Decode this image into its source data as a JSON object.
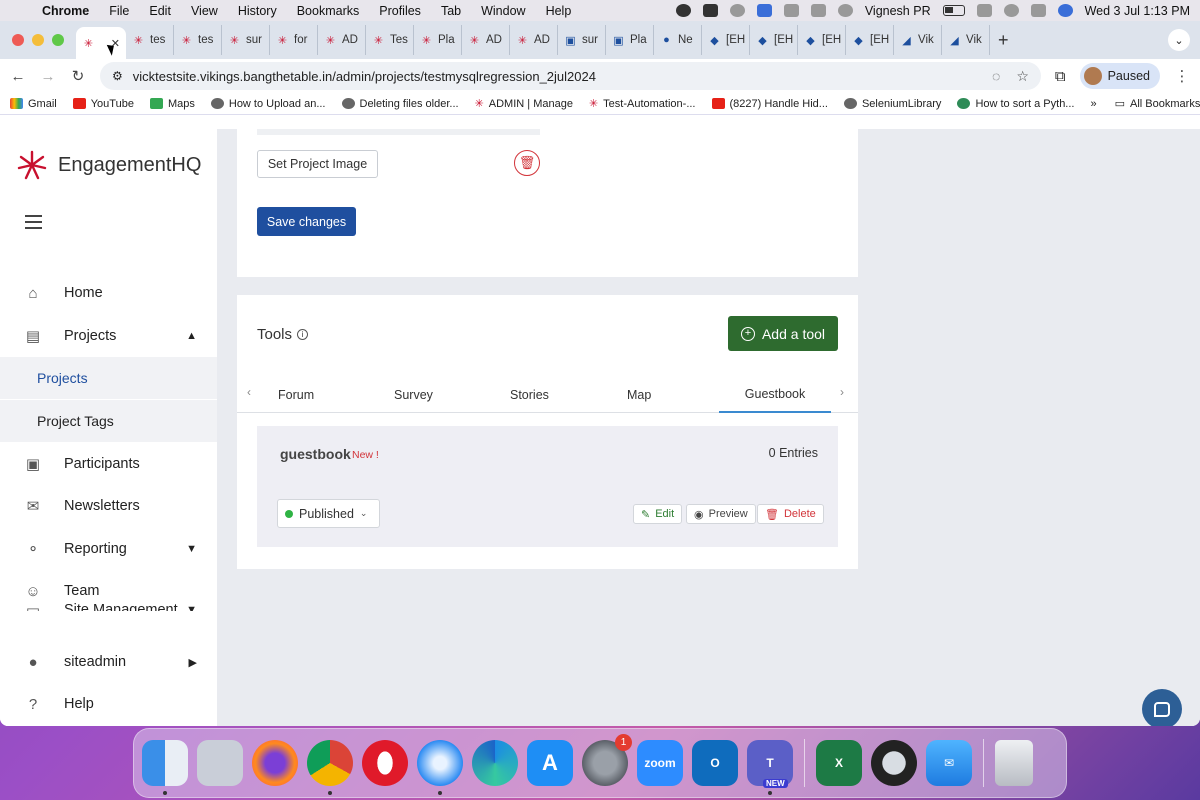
{
  "menubar": {
    "app": "Chrome",
    "items": [
      "File",
      "Edit",
      "View",
      "History",
      "Bookmarks",
      "Profiles",
      "Tab",
      "Window",
      "Help"
    ],
    "user": "Vignesh PR",
    "datetime": "Wed 3 Jul  1:13 PM"
  },
  "tabs": [
    {
      "label": "",
      "icon": "engagementhq-icon",
      "active": true
    },
    {
      "label": "tes"
    },
    {
      "label": "tes"
    },
    {
      "label": "sur"
    },
    {
      "label": "for"
    },
    {
      "label": "AD"
    },
    {
      "label": "Tes"
    },
    {
      "label": "Pla"
    },
    {
      "label": "AD"
    },
    {
      "label": "AD"
    },
    {
      "label": "sur"
    },
    {
      "label": "Pla"
    },
    {
      "label": "Ne"
    },
    {
      "label": "[EH"
    },
    {
      "label": "[EH"
    },
    {
      "label": "[EH"
    },
    {
      "label": "[EH"
    },
    {
      "label": "Vik"
    },
    {
      "label": "Vik"
    }
  ],
  "address_bar": {
    "url": "vicktestsite.vikings.bangthetable.in/admin/projects/testmysqlregression_2jul2024",
    "profile_label": "Paused"
  },
  "bookmarks": [
    "Gmail",
    "YouTube",
    "Maps",
    "How to Upload an...",
    "Deleting files older...",
    "ADMIN | Manage",
    "Test-Automation-...",
    "(8227) Handle Hid...",
    "SeleniumLibrary",
    "How to sort a Pyth..."
  ],
  "bookmarks_all": "All Bookmarks",
  "brand": "EngagementHQ",
  "sidebar": {
    "home": "Home",
    "projects": "Projects",
    "projects_sub": "Projects",
    "project_tags": "Project Tags",
    "participants": "Participants",
    "newsletters": "Newsletters",
    "reporting": "Reporting",
    "team": "Team",
    "site_management": "Site Management",
    "siteadmin": "siteadmin",
    "help": "Help"
  },
  "project_image": {
    "set_label": "Set Project Image",
    "save_label": "Save changes"
  },
  "tools": {
    "title": "Tools",
    "add_label": "Add a tool",
    "tabs": [
      "Forum",
      "Survey",
      "Stories",
      "Map",
      "Guestbook"
    ],
    "active_tab": "Guestbook",
    "item": {
      "name": "guestbook",
      "new_label": "New !",
      "entries": "0 Entries",
      "status": "Published",
      "edit": "Edit",
      "preview": "Preview",
      "delete": "Delete"
    }
  },
  "colors": {
    "primary": "#1f4f9f",
    "add_tool": "#2e6b2f",
    "danger": "#d2343a",
    "published_dot": "#2fb344"
  },
  "dock": [
    {
      "name": "finder-icon"
    },
    {
      "name": "launchpad-icon"
    },
    {
      "name": "firefox-icon"
    },
    {
      "name": "chrome-icon"
    },
    {
      "name": "opera-icon"
    },
    {
      "name": "safari-icon"
    },
    {
      "name": "edge-icon"
    },
    {
      "name": "app-store-icon"
    },
    {
      "name": "system-settings-icon",
      "badge": "1"
    },
    {
      "name": "zoom-icon",
      "label": "zoom"
    },
    {
      "name": "outlook-icon"
    },
    {
      "name": "teams-icon",
      "badge_new": "NEW"
    },
    {
      "name": "excel-icon"
    },
    {
      "name": "quicktime-icon"
    },
    {
      "name": "mail-icon"
    },
    {
      "name": "trash-icon"
    }
  ]
}
